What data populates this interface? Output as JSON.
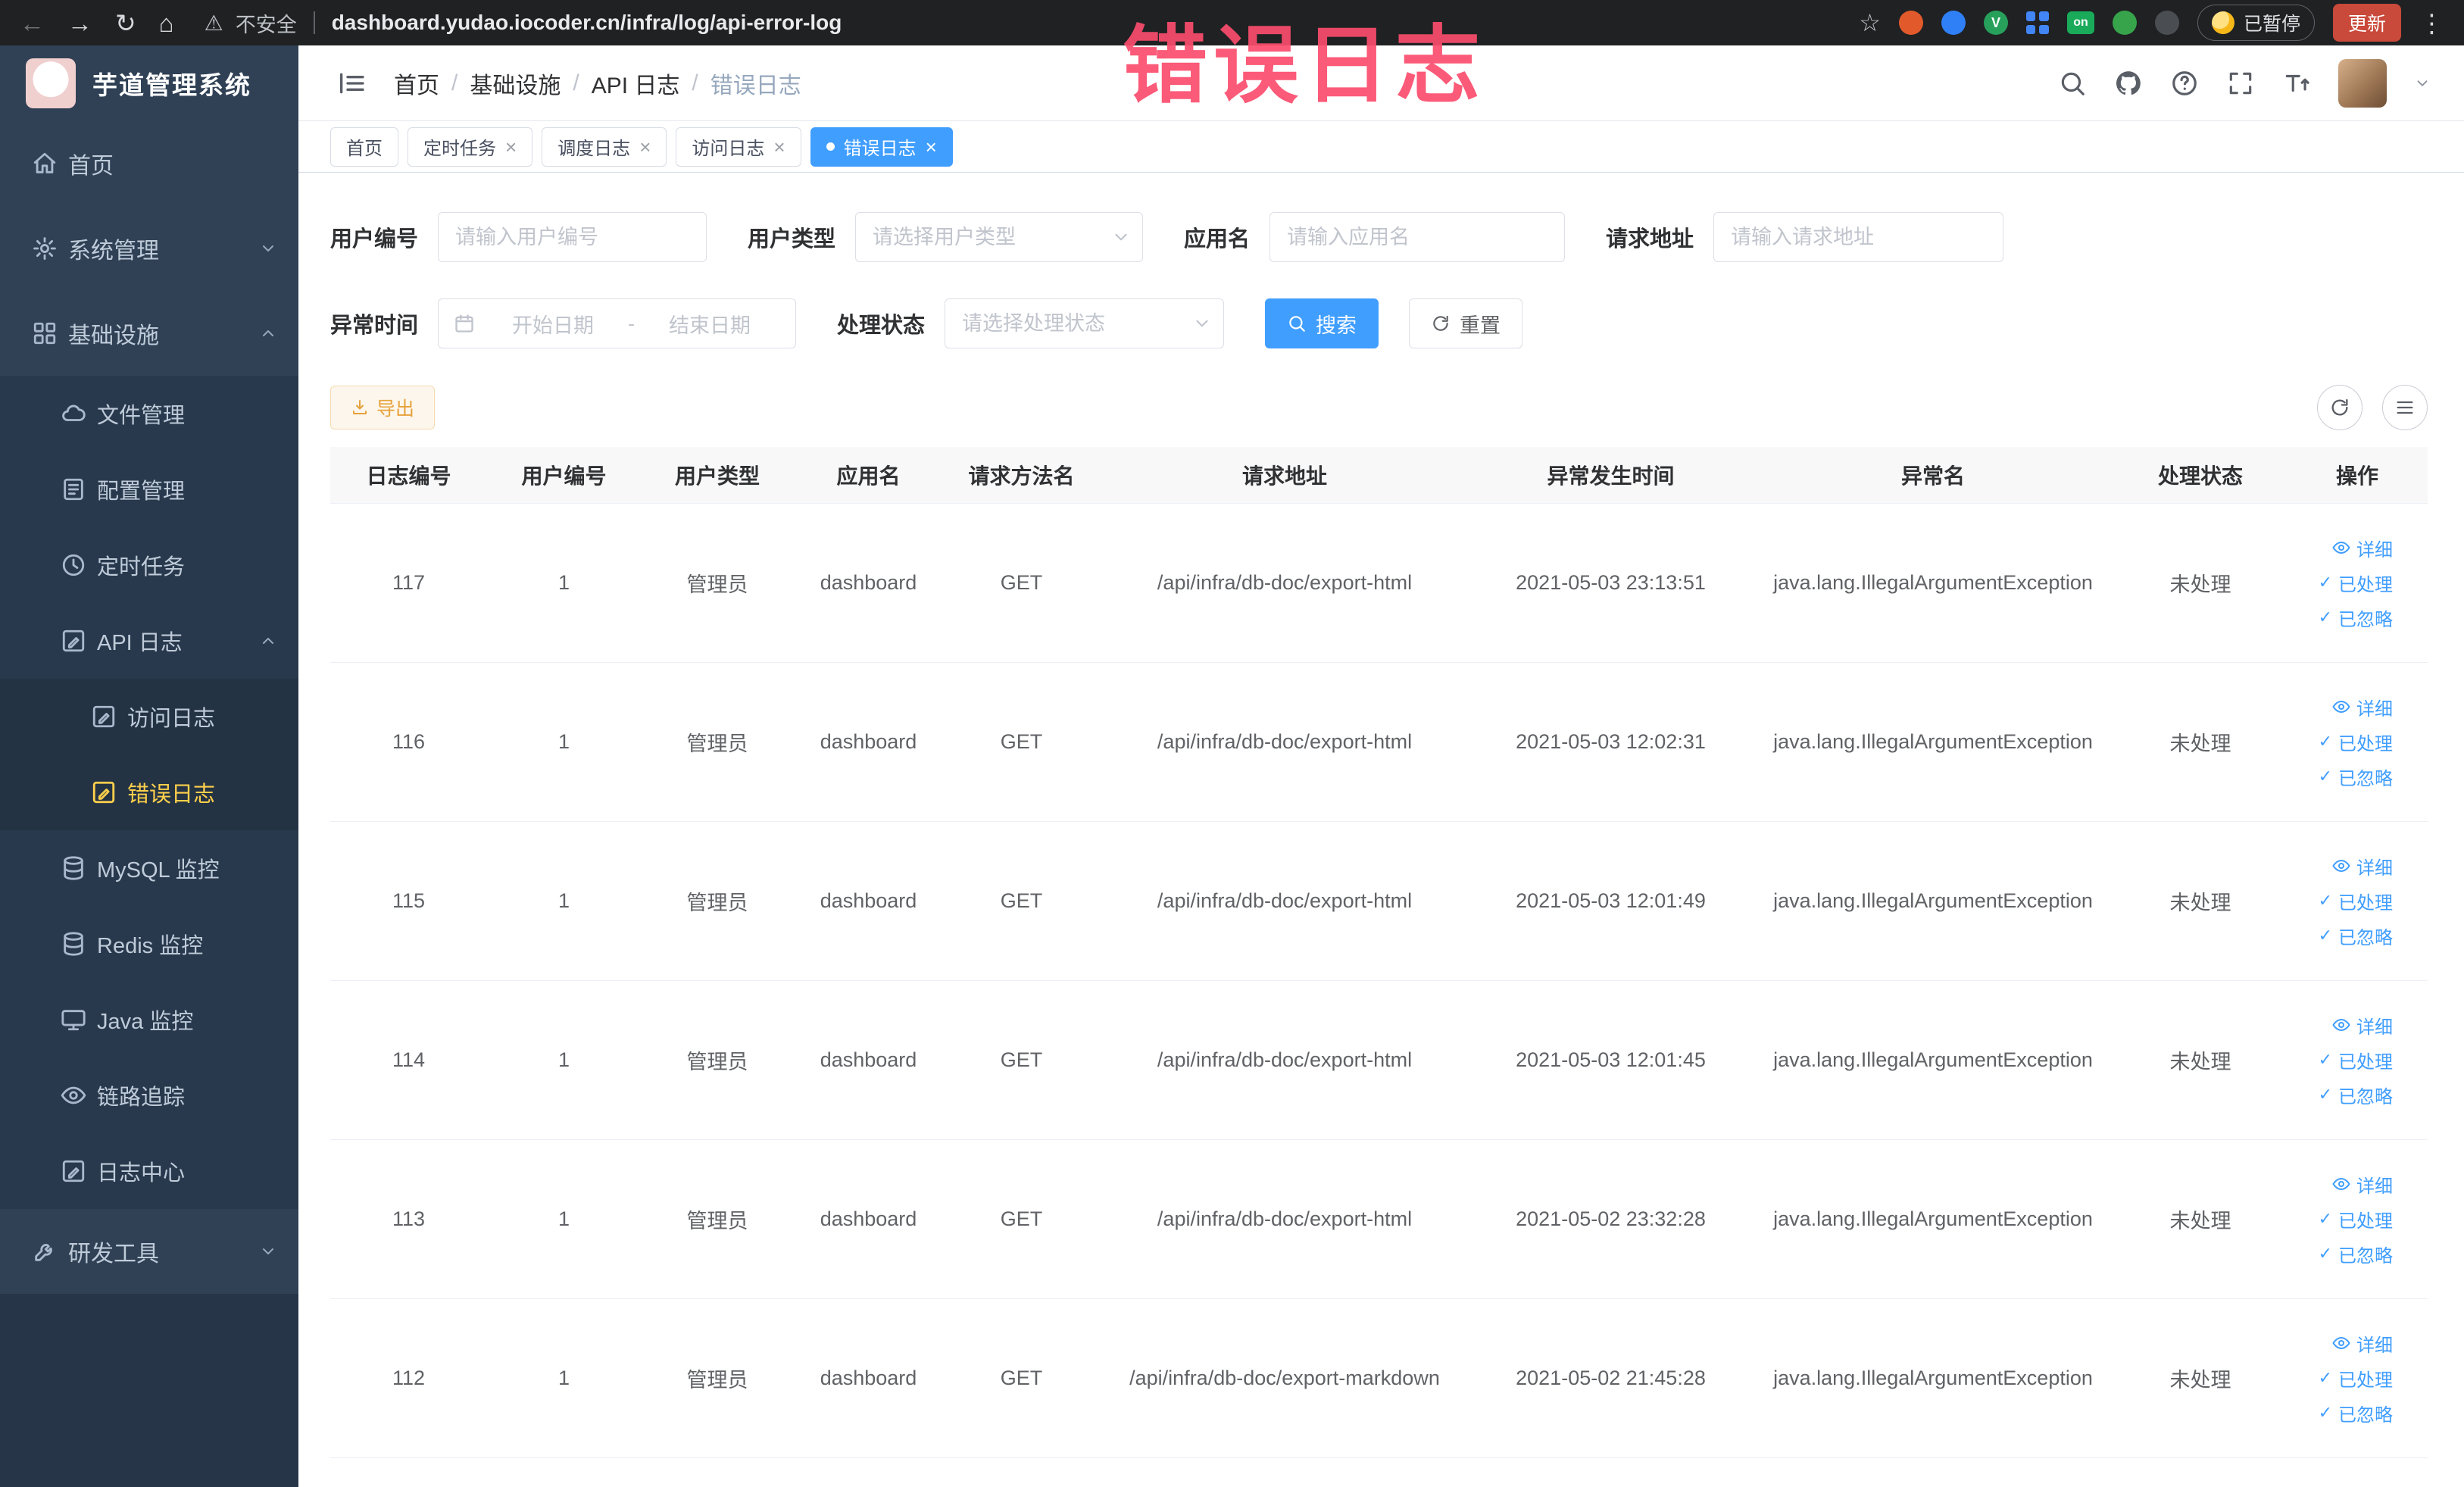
{
  "browser": {
    "security_label": "不安全",
    "url": "dashboard.yudao.iocoder.cn/infra/log/api-error-log",
    "paused_label": "已暂停",
    "update_label": "更新",
    "extension_v_label": "V",
    "extension_on_label": "on"
  },
  "icons": {
    "back": "←",
    "forward": "→",
    "reload": "↻",
    "home": "⌂",
    "warning": "⚠",
    "star": "☆",
    "overflow": "⋮",
    "close": "×",
    "check": "✓"
  },
  "watermark": "错误日志",
  "sidebar": {
    "logo_title": "芋道管理系统",
    "items": [
      {
        "label": "首页"
      },
      {
        "label": "系统管理"
      },
      {
        "label": "基础设施"
      },
      {
        "label": "文件管理"
      },
      {
        "label": "配置管理"
      },
      {
        "label": "定时任务"
      },
      {
        "label": "API 日志"
      },
      {
        "label": "访问日志"
      },
      {
        "label": "错误日志"
      },
      {
        "label": "MySQL 监控"
      },
      {
        "label": "Redis 监控"
      },
      {
        "label": "Java 监控"
      },
      {
        "label": "链路追踪"
      },
      {
        "label": "日志中心"
      },
      {
        "label": "研发工具"
      }
    ]
  },
  "header": {
    "breadcrumb": [
      "首页",
      "基础设施",
      "API 日志",
      "错误日志"
    ],
    "breadcrumb_separator": "/"
  },
  "tabs": [
    {
      "label": "首页"
    },
    {
      "label": "定时任务"
    },
    {
      "label": "调度日志"
    },
    {
      "label": "访问日志"
    },
    {
      "label": "错误日志"
    }
  ],
  "filters": {
    "user_id_label": "用户编号",
    "user_id_placeholder": "请输入用户编号",
    "user_type_label": "用户类型",
    "user_type_placeholder": "请选择用户类型",
    "app_name_label": "应用名",
    "app_name_placeholder": "请输入应用名",
    "request_url_label": "请求地址",
    "request_url_placeholder": "请输入请求地址",
    "exception_time_label": "异常时间",
    "date_start_placeholder": "开始日期",
    "date_separator": "-",
    "date_end_placeholder": "结束日期",
    "process_status_label": "处理状态",
    "process_status_placeholder": "请选择处理状态",
    "search_label": "搜索",
    "reset_label": "重置"
  },
  "toolbar": {
    "export_label": "导出"
  },
  "table": {
    "columns": [
      "日志编号",
      "用户编号",
      "用户类型",
      "应用名",
      "请求方法名",
      "请求地址",
      "异常发生时间",
      "异常名",
      "处理状态",
      "操作"
    ],
    "action_labels": [
      "详细",
      "已处理",
      "已忽略"
    ],
    "rows": [
      {
        "id": "117",
        "user_id": "1",
        "user_type": "管理员",
        "app_name": "dashboard",
        "method": "GET",
        "url": "/api/infra/db-doc/export-html",
        "time": "2021-05-03 23:13:51",
        "exception": "java.lang.IllegalArgumentException",
        "status": "未处理"
      },
      {
        "id": "116",
        "user_id": "1",
        "user_type": "管理员",
        "app_name": "dashboard",
        "method": "GET",
        "url": "/api/infra/db-doc/export-html",
        "time": "2021-05-03 12:02:31",
        "exception": "java.lang.IllegalArgumentException",
        "status": "未处理"
      },
      {
        "id": "115",
        "user_id": "1",
        "user_type": "管理员",
        "app_name": "dashboard",
        "method": "GET",
        "url": "/api/infra/db-doc/export-html",
        "time": "2021-05-03 12:01:49",
        "exception": "java.lang.IllegalArgumentException",
        "status": "未处理"
      },
      {
        "id": "114",
        "user_id": "1",
        "user_type": "管理员",
        "app_name": "dashboard",
        "method": "GET",
        "url": "/api/infra/db-doc/export-html",
        "time": "2021-05-03 12:01:45",
        "exception": "java.lang.IllegalArgumentException",
        "status": "未处理"
      },
      {
        "id": "113",
        "user_id": "1",
        "user_type": "管理员",
        "app_name": "dashboard",
        "method": "GET",
        "url": "/api/infra/db-doc/export-html",
        "time": "2021-05-02 23:32:28",
        "exception": "java.lang.IllegalArgumentException",
        "status": "未处理"
      },
      {
        "id": "112",
        "user_id": "1",
        "user_type": "管理员",
        "app_name": "dashboard",
        "method": "GET",
        "url": "/api/infra/db-doc/export-markdown",
        "time": "2021-05-02 21:45:28",
        "exception": "java.lang.IllegalArgumentException",
        "status": "未处理"
      }
    ]
  },
  "colors": {
    "accent": "#409eff",
    "sidebar_bg": "#304156",
    "sidebar_active_text": "#ffd04b",
    "watermark": "#fb4d6d",
    "export_button_text": "#e6a23c",
    "browser_bar_bg": "#1f2123"
  }
}
